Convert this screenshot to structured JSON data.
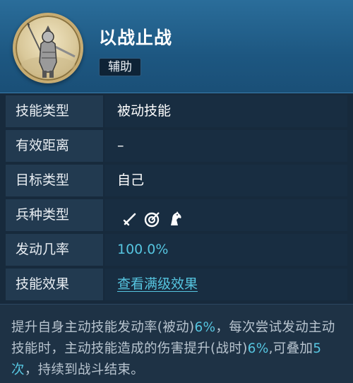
{
  "header": {
    "title": "以战止战",
    "tag": "辅助"
  },
  "rows": [
    {
      "label": "技能类型",
      "value": "被动技能"
    },
    {
      "label": "有效距离",
      "value": "–"
    },
    {
      "label": "目标类型",
      "value": "自己"
    },
    {
      "label": "兵种类型",
      "icons": [
        "sword-icon",
        "bow-target-icon",
        "horse-icon"
      ]
    },
    {
      "label": "发动几率",
      "value": "100.0%"
    },
    {
      "label": "技能效果",
      "value": "查看满级效果"
    }
  ],
  "description": {
    "part1": "提升自身主动技能发动率(被动)",
    "pct1": "6%",
    "part2": "，每次尝试发动主动技能时，主动技能造成的伤害提升(战时)",
    "pct2": "6%",
    "part3": ",可叠加",
    "stacks": "5次",
    "part4": "，持续到战斗结束。"
  },
  "colors": {
    "accent": "#56c5e0",
    "header_bg": "#1d5781",
    "label_bg": "#223a50",
    "value_bg": "#182d41"
  }
}
